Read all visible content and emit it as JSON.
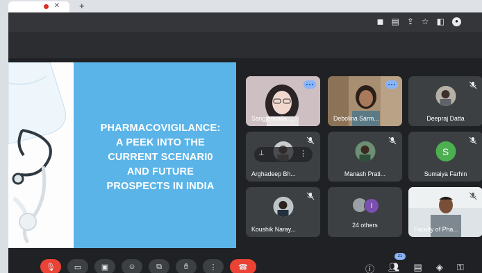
{
  "browser": {
    "tab_close_glyph": "✕",
    "new_tab_glyph": "+",
    "address_icons": [
      "camera-icon",
      "translate-icon",
      "share-icon",
      "bookmark-star-icon",
      "sidepanel-icon",
      "extension-icon"
    ]
  },
  "slide": {
    "title_line1": "PHARMACOVIGILANCE:",
    "title_line2": "A PEEK INTO THE",
    "title_line3": "CURRENT SCENARI0",
    "title_line4": "AND FUTURE",
    "title_line5": "PROSPECTS IN INDIA",
    "background_color": "#5bb4e8"
  },
  "participants": [
    {
      "name": "Sangjennaila ...",
      "muted": false,
      "speaking": true
    },
    {
      "name": "Debolina Sarm...",
      "muted": false,
      "speaking": true
    },
    {
      "name": "Deepraj Datta",
      "muted": true
    },
    {
      "name": "Arghadeep Bh...",
      "muted": true
    },
    {
      "name": "Manash Prati...",
      "muted": true
    },
    {
      "name": "Sumaiya Farhin",
      "muted": true,
      "initial": "S",
      "avatar_color": "#4caf50"
    },
    {
      "name": "Koushik Naray...",
      "muted": true
    },
    {
      "name": "24 others",
      "muted": false,
      "initial": "I"
    },
    {
      "name": "Faculty of Pha...",
      "muted": true
    }
  ],
  "toolbar": {
    "people_count": "21",
    "buttons": [
      "mic-off-icon",
      "camera-icon",
      "captions-icon",
      "emoji-icon",
      "present-icon",
      "raise-hand-icon",
      "more-icon",
      "hang-up-icon"
    ],
    "right_buttons": [
      "info-icon",
      "people-icon",
      "chat-icon",
      "activities-icon",
      "host-controls-icon"
    ]
  }
}
